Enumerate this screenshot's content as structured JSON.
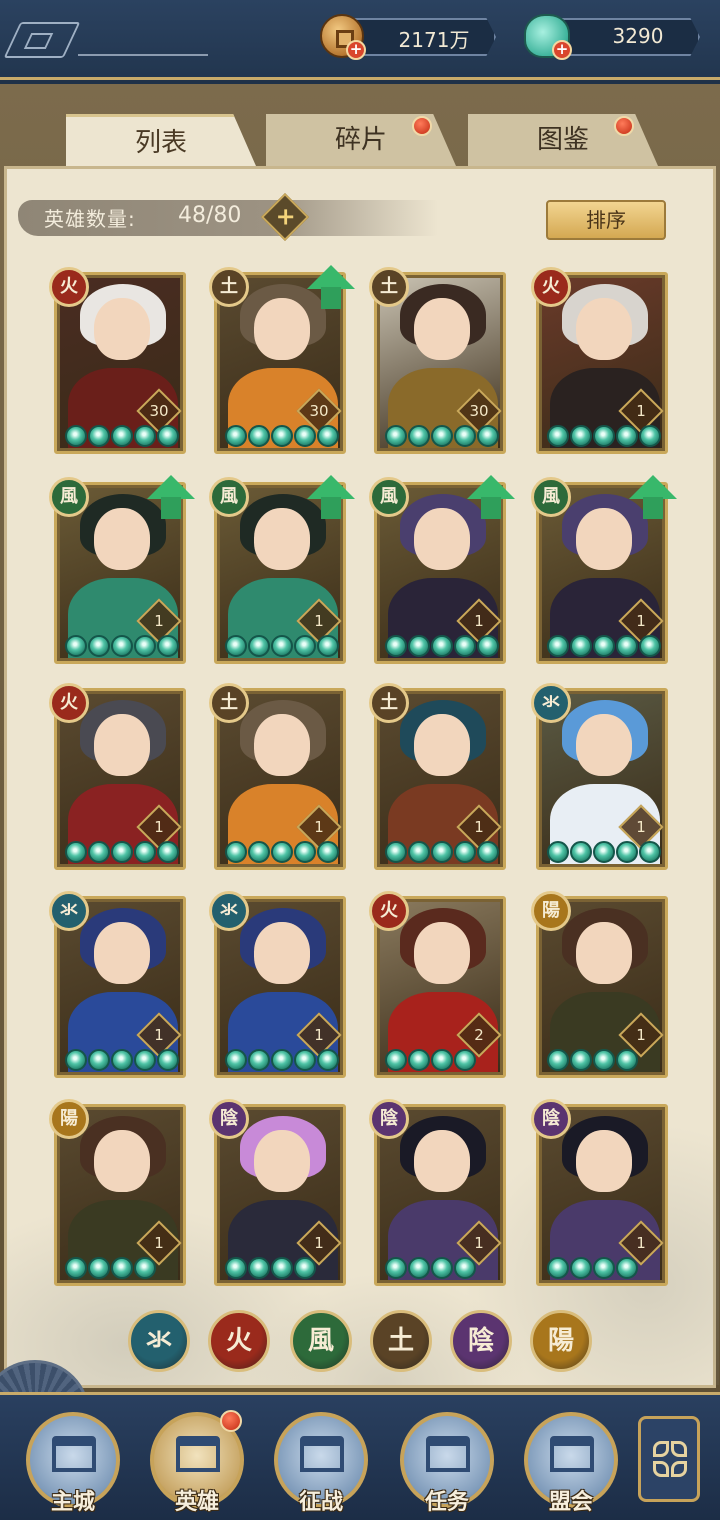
{
  "currencies": {
    "coins": {
      "value": "2171万",
      "icon": "coin-icon"
    },
    "jade": {
      "value": "3290",
      "icon": "jade-icon"
    }
  },
  "tabs": [
    {
      "label": "列表",
      "active": true,
      "dot": false
    },
    {
      "label": "碎片",
      "active": false,
      "dot": true
    },
    {
      "label": "图鉴",
      "active": false,
      "dot": true
    }
  ],
  "hero_count": {
    "label": "英雄数量:",
    "value": "48/80"
  },
  "sort_label": "排序",
  "elements": {
    "水": {
      "glyph": "氺",
      "color": "#23606e"
    },
    "火": {
      "glyph": "火",
      "color": "#9a2a1c"
    },
    "风": {
      "glyph": "風",
      "color": "#2d6a3a"
    },
    "土": {
      "glyph": "土",
      "color": "#5a4326"
    },
    "阴": {
      "glyph": "陰",
      "color": "#5b3470"
    },
    "阳": {
      "glyph": "陽",
      "color": "#a8761c"
    }
  },
  "heroes": [
    {
      "element": "火",
      "glyph": "火",
      "level": "30",
      "stars": 5,
      "upgrade": false,
      "hair": "#e9e6e2",
      "outfit": "#6a1f1a",
      "bg": "#4a2c22"
    },
    {
      "element": "土",
      "glyph": "土",
      "level": "30",
      "stars": 5,
      "upgrade": true,
      "hair": "#6b5a45",
      "outfit": "#d9822a",
      "bg": "#5a4a30"
    },
    {
      "element": "土",
      "glyph": "土",
      "level": "30",
      "stars": 5,
      "upgrade": false,
      "hair": "#3a2a22",
      "outfit": "#8a6a2a",
      "bg": "#c9c2b2"
    },
    {
      "element": "火",
      "glyph": "火",
      "level": "1",
      "stars": 5,
      "upgrade": false,
      "hair": "#d8d4ce",
      "outfit": "#2a2220",
      "bg": "#6a3a2a"
    },
    {
      "element": "风",
      "glyph": "風",
      "level": "1",
      "stars": 5,
      "upgrade": true,
      "hair": "#1f2a24",
      "outfit": "#2f8a6e",
      "bg": "#6a5a36"
    },
    {
      "element": "风",
      "glyph": "風",
      "level": "1",
      "stars": 5,
      "upgrade": true,
      "hair": "#1f2a24",
      "outfit": "#2f8a6e",
      "bg": "#6a5a36"
    },
    {
      "element": "风",
      "glyph": "風",
      "level": "1",
      "stars": 5,
      "upgrade": true,
      "hair": "#4a3f6e",
      "outfit": "#2a2438",
      "bg": "#6a5a36"
    },
    {
      "element": "风",
      "glyph": "風",
      "level": "1",
      "stars": 5,
      "upgrade": true,
      "hair": "#4a3f6e",
      "outfit": "#2a2438",
      "bg": "#6a5a36"
    },
    {
      "element": "火",
      "glyph": "火",
      "level": "1",
      "stars": 5,
      "upgrade": false,
      "hair": "#4a4a52",
      "outfit": "#8a2222",
      "bg": "#5a4a30"
    },
    {
      "element": "土",
      "glyph": "土",
      "level": "1",
      "stars": 5,
      "upgrade": false,
      "hair": "#6b5a45",
      "outfit": "#d9822a",
      "bg": "#5a4a30"
    },
    {
      "element": "土",
      "glyph": "土",
      "level": "1",
      "stars": 5,
      "upgrade": false,
      "hair": "#1f4a5a",
      "outfit": "#7a3a22",
      "bg": "#5a4a30"
    },
    {
      "element": "水",
      "glyph": "氺",
      "level": "1",
      "stars": 5,
      "upgrade": false,
      "hair": "#5a9ad8",
      "outfit": "#e8eef4",
      "bg": "#5a5a44"
    },
    {
      "element": "水",
      "glyph": "氺",
      "level": "1",
      "stars": 5,
      "upgrade": false,
      "hair": "#2a3a7a",
      "outfit": "#2a4a9a",
      "bg": "#5a4a30"
    },
    {
      "element": "水",
      "glyph": "氺",
      "level": "1",
      "stars": 5,
      "upgrade": false,
      "hair": "#2a3a7a",
      "outfit": "#2a4a9a",
      "bg": "#5a4a30"
    },
    {
      "element": "火",
      "glyph": "火",
      "level": "2",
      "stars": 4,
      "upgrade": false,
      "hair": "#5a2a1e",
      "outfit": "#a8221c",
      "bg": "#8a7a5e"
    },
    {
      "element": "阳",
      "glyph": "陽",
      "level": "1",
      "stars": 4,
      "upgrade": false,
      "hair": "#4a3022",
      "outfit": "#3a3a22",
      "bg": "#5a4a30"
    },
    {
      "element": "阳",
      "glyph": "陽",
      "level": "1",
      "stars": 4,
      "upgrade": false,
      "hair": "#4a3022",
      "outfit": "#3a3a22",
      "bg": "#5a4a30"
    },
    {
      "element": "阴",
      "glyph": "陰",
      "level": "1",
      "stars": 4,
      "upgrade": false,
      "hair": "#c88ad8",
      "outfit": "#2a2a3a",
      "bg": "#5a4a30"
    },
    {
      "element": "阴",
      "glyph": "陰",
      "level": "1",
      "stars": 4,
      "upgrade": false,
      "hair": "#1a1a26",
      "outfit": "#4a3a6a",
      "bg": "#5a4a30"
    },
    {
      "element": "阴",
      "glyph": "陰",
      "level": "1",
      "stars": 4,
      "upgrade": false,
      "hair": "#1a1a26",
      "outfit": "#4a3a6a",
      "bg": "#5a4a30"
    }
  ],
  "filters": [
    {
      "element": "水",
      "glyph": "氺",
      "color": "#23606e"
    },
    {
      "element": "火",
      "glyph": "火",
      "color": "#9a2a1c"
    },
    {
      "element": "风",
      "glyph": "風",
      "color": "#2d6a3a"
    },
    {
      "element": "土",
      "glyph": "土",
      "color": "#5a4326"
    },
    {
      "element": "阴",
      "glyph": "陰",
      "color": "#5b3470"
    },
    {
      "element": "阳",
      "glyph": "陽",
      "color": "#a8761c"
    }
  ],
  "nav": [
    {
      "label": "主城",
      "icon": "city-icon",
      "active": false
    },
    {
      "label": "英雄",
      "icon": "hero-icon",
      "active": true
    },
    {
      "label": "征战",
      "icon": "battle-icon",
      "active": false
    },
    {
      "label": "任务",
      "icon": "task-icon",
      "active": false
    },
    {
      "label": "盟会",
      "icon": "alliance-icon",
      "active": false
    }
  ],
  "more_icon": "flower-menu-icon"
}
